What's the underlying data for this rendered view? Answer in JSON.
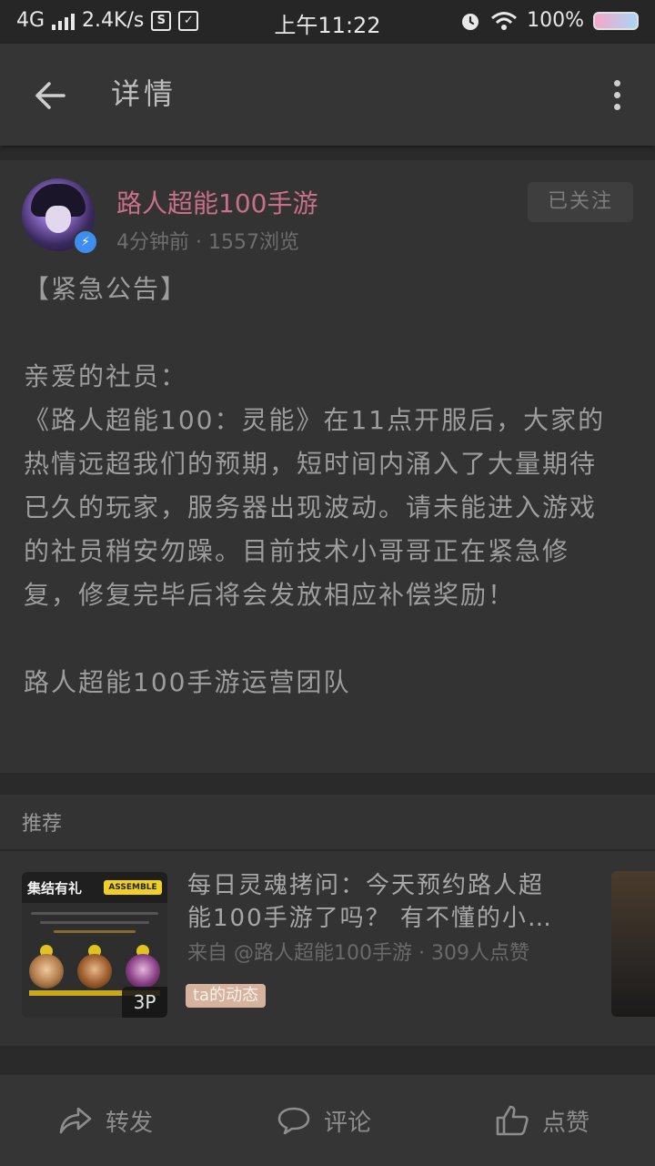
{
  "status_bar": {
    "network": "4G",
    "speed": "2.4K/s",
    "s_icon_label": "S",
    "time": "上午11:22",
    "battery_percent": "100%"
  },
  "header": {
    "title": "详情"
  },
  "post": {
    "author": "路人超能100手游",
    "meta": "4分钟前 · 1557浏览",
    "follow_label": "已关注",
    "body": {
      "headline": "【紧急公告】",
      "greeting": "亲爱的社员：",
      "paragraph": "《路人超能100：灵能》在11点开服后，大家的热情远超我们的预期，短时间内涌入了大量期待已久的玩家，服务器出现波动。请未能进入游戏的社员稍安勿躁。目前技术小哥哥正在紧急修复，修复完毕后将会发放相应补偿奖励！",
      "signature": "路人超能100手游运营团队"
    }
  },
  "recommend": {
    "header": "推荐",
    "item": {
      "title_line1": "每日灵魂拷问：今天预约路人超",
      "title_line2": "能100手游了吗？ 有不懂的小…",
      "source": "来自 @路人超能100手游 · 309人点赞",
      "tag": "ta的动态",
      "thumb_title": "集结有礼",
      "thumb_tag": "ASSEMBLE",
      "image_count": "3P"
    }
  },
  "actions": {
    "share_label": "转发",
    "comment_label": "评论",
    "like_label": "点赞"
  },
  "colors": {
    "author_name": "#c96f8a",
    "verified": "#3d8ef0",
    "tag_bg": "#d5b39f"
  },
  "icons": [
    "back-arrow-icon",
    "more-vertical-icon",
    "verified-icon",
    "share-icon",
    "comment-icon",
    "like-icon",
    "wifi-icon",
    "alarm-icon"
  ]
}
